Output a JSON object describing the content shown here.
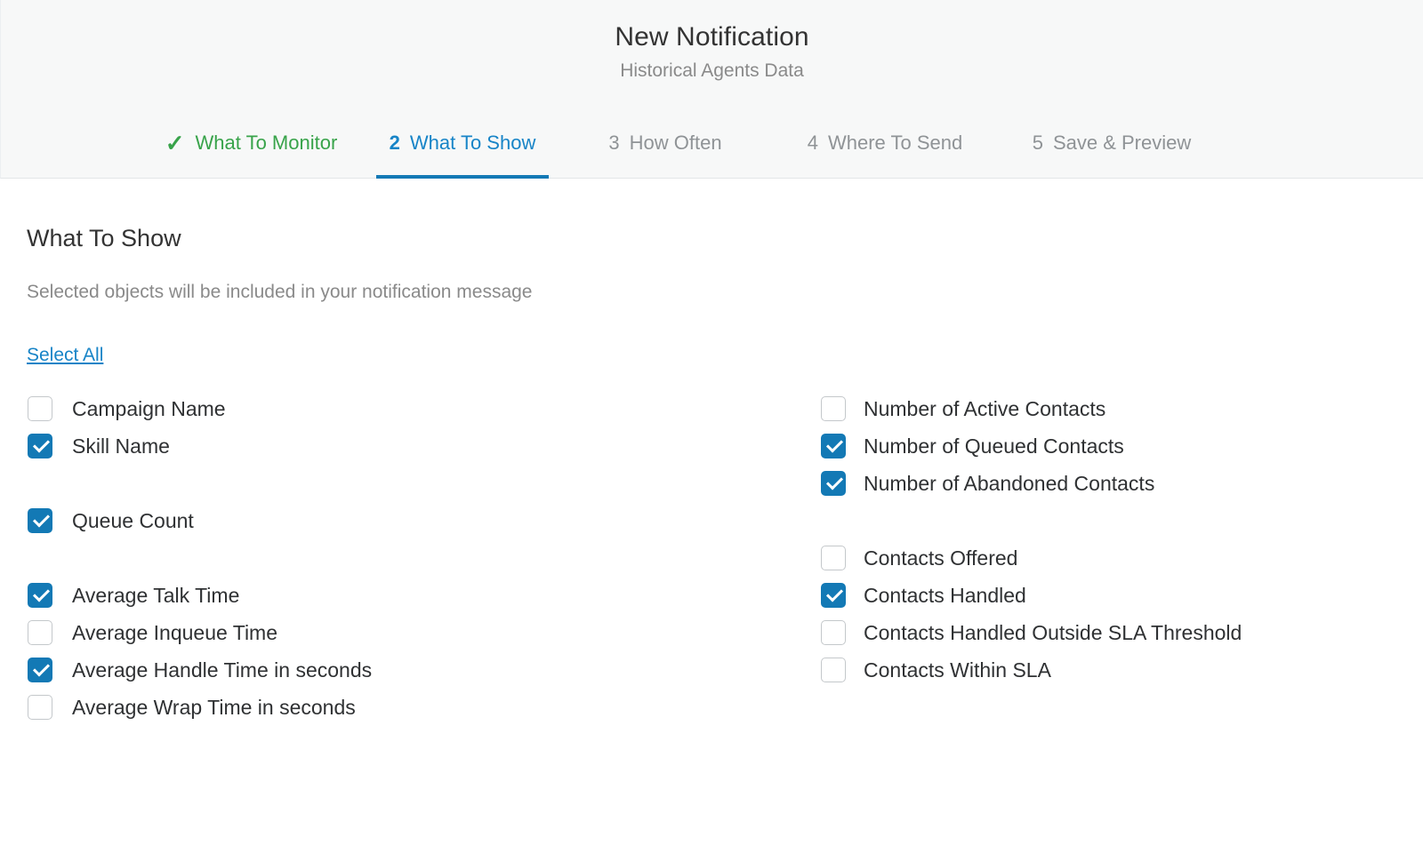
{
  "header": {
    "title": "New Notification",
    "subtitle": "Historical Agents Data"
  },
  "steps": [
    {
      "num": "✓",
      "label": "What To Monitor",
      "state": "done"
    },
    {
      "num": "2",
      "label": "What To Show",
      "state": "active"
    },
    {
      "num": "3",
      "label": "How Often",
      "state": "todo"
    },
    {
      "num": "4",
      "label": "Where To Send",
      "state": "todo"
    },
    {
      "num": "5",
      "label": "Save & Preview",
      "state": "todo"
    }
  ],
  "main": {
    "section_title": "What To Show",
    "section_subtitle": "Selected objects will be included in your notification message",
    "select_all_label": "Select All"
  },
  "left_column": [
    {
      "items": [
        {
          "label": "Campaign Name",
          "checked": false
        },
        {
          "label": "Skill Name",
          "checked": true
        }
      ]
    },
    {
      "items": [
        {
          "label": "Queue Count",
          "checked": true
        }
      ]
    },
    {
      "items": [
        {
          "label": "Average Talk Time",
          "checked": true
        },
        {
          "label": "Average Inqueue Time",
          "checked": false
        },
        {
          "label": "Average Handle Time in seconds",
          "checked": true
        },
        {
          "label": "Average Wrap Time in seconds",
          "checked": false
        }
      ]
    }
  ],
  "right_column": [
    {
      "items": [
        {
          "label": "Number of Active Contacts",
          "checked": false
        },
        {
          "label": "Number of Queued Contacts",
          "checked": true
        },
        {
          "label": "Number of Abandoned Contacts",
          "checked": true
        }
      ]
    },
    {
      "items": [
        {
          "label": "Contacts Offered",
          "checked": false
        },
        {
          "label": "Contacts Handled",
          "checked": true
        },
        {
          "label": "Contacts Handled Outside SLA Threshold",
          "checked": false
        },
        {
          "label": "Contacts Within SLA",
          "checked": false
        }
      ]
    }
  ],
  "colors": {
    "accent_blue": "#1379b5",
    "link_blue": "#1784c7",
    "done_green": "#38a34a",
    "header_bg": "#f7f8f8",
    "muted_text": "#8a8a8a",
    "body_text": "#2f3133"
  }
}
